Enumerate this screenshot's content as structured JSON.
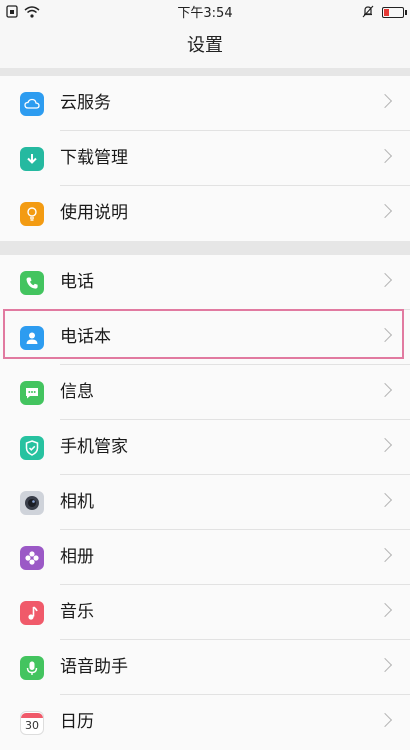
{
  "status_bar": {
    "time": "下午3:54",
    "battery_level": 0.3,
    "battery_color": "#e53935",
    "icons_left": [
      "sim-icon",
      "wifi-icon"
    ],
    "icons_right": [
      "bell-muted-icon",
      "battery-icon"
    ]
  },
  "header": {
    "title": "设置"
  },
  "sections": [
    {
      "items": [
        {
          "label": "云服务",
          "icon": "cloud-icon",
          "color": "#2d9cf0"
        },
        {
          "label": "下载管理",
          "icon": "download-icon",
          "color": "#25b9a0"
        },
        {
          "label": "使用说明",
          "icon": "bulb-icon",
          "color": "#f39b12"
        }
      ]
    },
    {
      "items": [
        {
          "label": "电话",
          "icon": "phone-icon",
          "color": "#43c45f"
        },
        {
          "label": "电话本",
          "icon": "contacts-icon",
          "color": "#2d9cf0",
          "highlighted": true
        },
        {
          "label": "信息",
          "icon": "message-icon",
          "color": "#43c45f"
        },
        {
          "label": "手机管家",
          "icon": "shield-icon",
          "color": "#27c2a0"
        },
        {
          "label": "相机",
          "icon": "camera-icon",
          "color": "#cfd3da"
        },
        {
          "label": "相册",
          "icon": "album-icon",
          "color": "#9b59c6"
        },
        {
          "label": "音乐",
          "icon": "music-icon",
          "color": "#f05a6a"
        },
        {
          "label": "语音助手",
          "icon": "mic-icon",
          "color": "#43c45f"
        },
        {
          "label": "日历",
          "icon": "calendar-icon",
          "color": "#ffffff",
          "calendar_day": "30"
        }
      ]
    }
  ]
}
